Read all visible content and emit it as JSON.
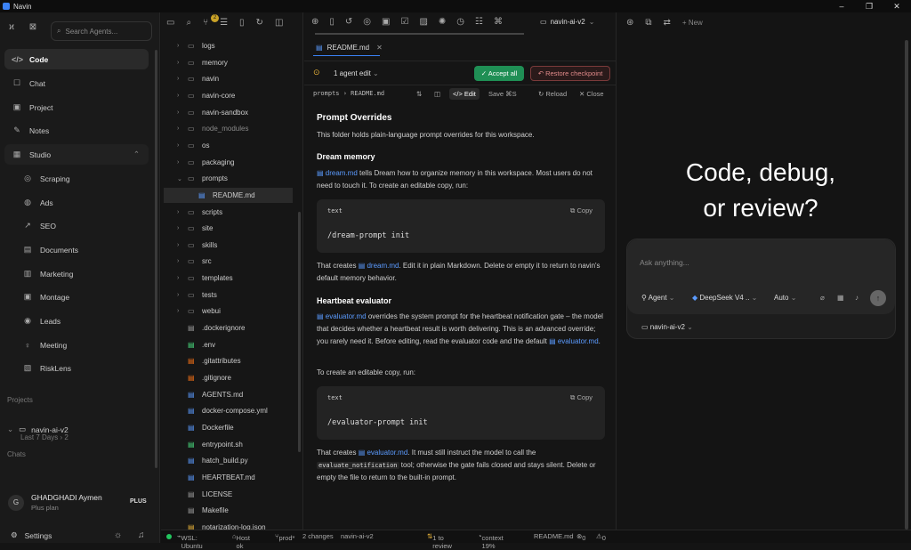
{
  "window": {
    "title": "Navin",
    "controls": [
      "–",
      "❐",
      "✕"
    ]
  },
  "sidebar": {
    "search_placeholder": "Search Agents...",
    "nav": [
      {
        "label": "Code",
        "icon": "code-icon",
        "glyph": "</>",
        "active": true
      },
      {
        "label": "Chat",
        "icon": "chat-icon",
        "glyph": "☐"
      },
      {
        "label": "Project",
        "icon": "project-icon",
        "glyph": "▣"
      },
      {
        "label": "Notes",
        "icon": "notes-icon",
        "glyph": "✎"
      },
      {
        "label": "Studio",
        "icon": "studio-icon",
        "glyph": "▦",
        "expanded": true
      }
    ],
    "studio_items": [
      {
        "label": "Scraping",
        "glyph": "◎"
      },
      {
        "label": "Ads",
        "glyph": "◍"
      },
      {
        "label": "SEO",
        "glyph": "↗"
      },
      {
        "label": "Documents",
        "glyph": "▤"
      },
      {
        "label": "Marketing",
        "glyph": "▥"
      },
      {
        "label": "Montage",
        "glyph": "▣"
      },
      {
        "label": "Leads",
        "glyph": "◉"
      },
      {
        "label": "Meeting",
        "glyph": "♀"
      },
      {
        "label": "RiskLens",
        "glyph": "▧"
      }
    ],
    "projects_label": "Projects",
    "project_name": "navin-ai-v2",
    "project_sub": "Last 7 Days",
    "project_count": "2",
    "chats_label": "Chats",
    "user": {
      "initial": "G",
      "name": "GHADGHADI Aymen",
      "plan": "Plus plan",
      "badge": "PLUS"
    },
    "settings_label": "Settings"
  },
  "explorer": {
    "badge": "2",
    "items": [
      {
        "name": "logs",
        "type": "folder"
      },
      {
        "name": "memory",
        "type": "folder"
      },
      {
        "name": "navin",
        "type": "folder"
      },
      {
        "name": "navin-core",
        "type": "folder"
      },
      {
        "name": "navin-sandbox",
        "type": "folder"
      },
      {
        "name": "node_modules",
        "type": "folder",
        "dim": true
      },
      {
        "name": "os",
        "type": "folder"
      },
      {
        "name": "packaging",
        "type": "folder"
      },
      {
        "name": "prompts",
        "type": "folder",
        "open": true
      },
      {
        "name": "README.md",
        "type": "file",
        "child": true,
        "selected": true,
        "color": "#5b9bff"
      },
      {
        "name": "scripts",
        "type": "folder"
      },
      {
        "name": "site",
        "type": "folder"
      },
      {
        "name": "skills",
        "type": "folder"
      },
      {
        "name": "src",
        "type": "folder"
      },
      {
        "name": "templates",
        "type": "folder"
      },
      {
        "name": "tests",
        "type": "folder"
      },
      {
        "name": "webui",
        "type": "folder"
      },
      {
        "name": ".dockerignore",
        "type": "file",
        "color": "#999"
      },
      {
        "name": ".env",
        "type": "file",
        "color": "#4ade80"
      },
      {
        "name": ".gitattributes",
        "type": "file",
        "color": "#f97316"
      },
      {
        "name": ".gitignore",
        "type": "file",
        "color": "#f97316"
      },
      {
        "name": "AGENTS.md",
        "type": "file",
        "color": "#5b9bff"
      },
      {
        "name": "docker-compose.yml",
        "type": "file",
        "color": "#5b9bff"
      },
      {
        "name": "Dockerfile",
        "type": "file",
        "color": "#5b9bff"
      },
      {
        "name": "entrypoint.sh",
        "type": "file",
        "color": "#4ade80"
      },
      {
        "name": "hatch_build.py",
        "type": "file",
        "color": "#5b9bff"
      },
      {
        "name": "HEARTBEAT.md",
        "type": "file",
        "color": "#5b9bff"
      },
      {
        "name": "LICENSE",
        "type": "file",
        "color": "#999"
      },
      {
        "name": "Makefile",
        "type": "file",
        "color": "#999"
      },
      {
        "name": "notarization-log.json",
        "type": "file",
        "color": "#e8b339"
      }
    ]
  },
  "editor": {
    "branch": "navin-ai-v2",
    "tab": "README.md",
    "agent_edit": "1 agent edit",
    "accept": "✓ Accept all",
    "restore": "↶ Restore checkpoint",
    "path": "prompts › README.md",
    "actions": {
      "edit": "</> Edit",
      "save": "Save ⌘S",
      "reload": "↻ Reload",
      "close": "✕ Close"
    },
    "doc": {
      "title": "Prompt Overrides",
      "intro": "This folder holds plain-language prompt overrides for this workspace.",
      "s1_title": "Dream memory",
      "s1_link": "dream.md",
      "s1_text": " tells Dream how to organize memory in this workspace. Most users do not need to touch it. To create an editable copy, run:",
      "code_lang": "text",
      "copy": "Copy",
      "code1": "/dream-prompt init",
      "s1b_pre": "That creates ",
      "s1b_link": "dream.md",
      "s1b_text": ". Edit it in plain Markdown. Delete or empty it to return to navin's default memory behavior.",
      "s2_title": "Heartbeat evaluator",
      "s2_link": "evaluator.md",
      "s2_text": " overrides the system prompt for the heartbeat notification gate – the model that decides whether a heartbeat result is worth delivering. This is an advanced override; you rarely need it. Before editing, read the evaluator code and the default ",
      "s2_link2": "evaluator.md",
      "s2_end": ".",
      "s2_copy_line": "To create an editable copy, run:",
      "code2": "/evaluator-prompt init",
      "s3_pre": "That creates ",
      "s3_link": "evaluator.md",
      "s3_text": ". It must still instruct the model to call the ",
      "s3_code": "evaluate_notification",
      "s3_text2": " tool; otherwise the gate fails closed and stays silent. Delete or empty the file to return to the built-in prompt."
    }
  },
  "right": {
    "new_label": "+ New",
    "hero_line1": "Code, debug,",
    "hero_line2": "or review?",
    "chat_placeholder": "Ask anything...",
    "agent": "Agent",
    "model": "DeepSeek V4 ..",
    "mode": "Auto",
    "workspace": "navin-ai-v2"
  },
  "status": {
    "wsl": "WSL: Ubuntu",
    "host": "Host ok",
    "branch": "prod*",
    "changes": "2 changes",
    "ws": "navin-ai-v2",
    "review": "1 to review",
    "context": "context 19%",
    "file": "README.md",
    "errors": "0",
    "warnings": "0"
  },
  "colors": {
    "accent": "#3b82f6",
    "success": "#1f8f55",
    "link": "#5b9bff",
    "warning": "#e8b339"
  }
}
